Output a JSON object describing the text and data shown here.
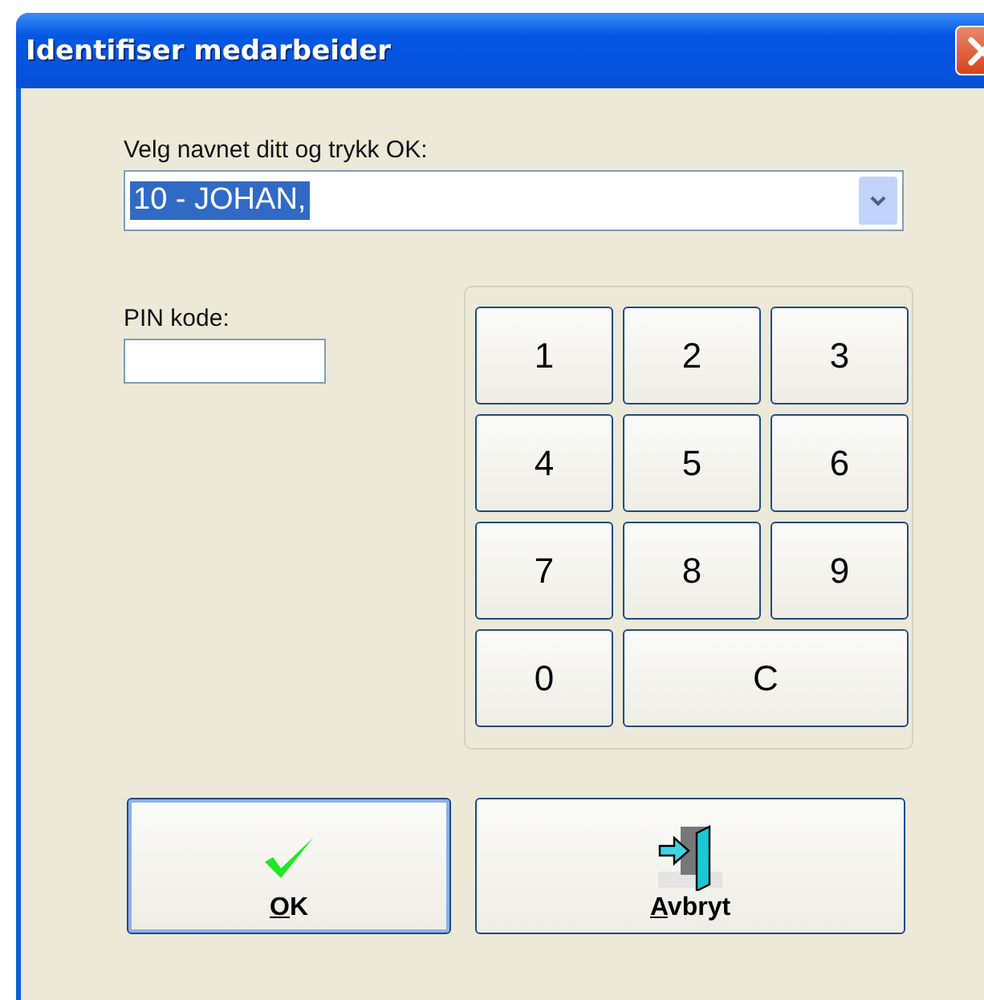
{
  "window": {
    "title": "Identifiser medarbeider"
  },
  "name_field": {
    "label": "Velg navnet ditt og trykk OK:",
    "value": "10 - JOHAN,",
    "text_selected": true
  },
  "pin_field": {
    "label": "PIN kode:"
  },
  "keypad": [
    {
      "label": "1",
      "wide": false
    },
    {
      "label": "2",
      "wide": false
    },
    {
      "label": "3",
      "wide": false
    },
    {
      "label": "4",
      "wide": false
    },
    {
      "label": "5",
      "wide": false
    },
    {
      "label": "6",
      "wide": false
    },
    {
      "label": "7",
      "wide": false
    },
    {
      "label": "8",
      "wide": false
    },
    {
      "label": "9",
      "wide": false
    },
    {
      "label": "0",
      "wide": false
    },
    {
      "label": "C",
      "wide": true
    }
  ],
  "buttons": [
    {
      "kind": "ok",
      "label": "OK",
      "mnemonic": true,
      "default": true
    },
    {
      "kind": "cancel",
      "label": "Avbryt",
      "mnemonic": true,
      "default": false
    }
  ]
}
